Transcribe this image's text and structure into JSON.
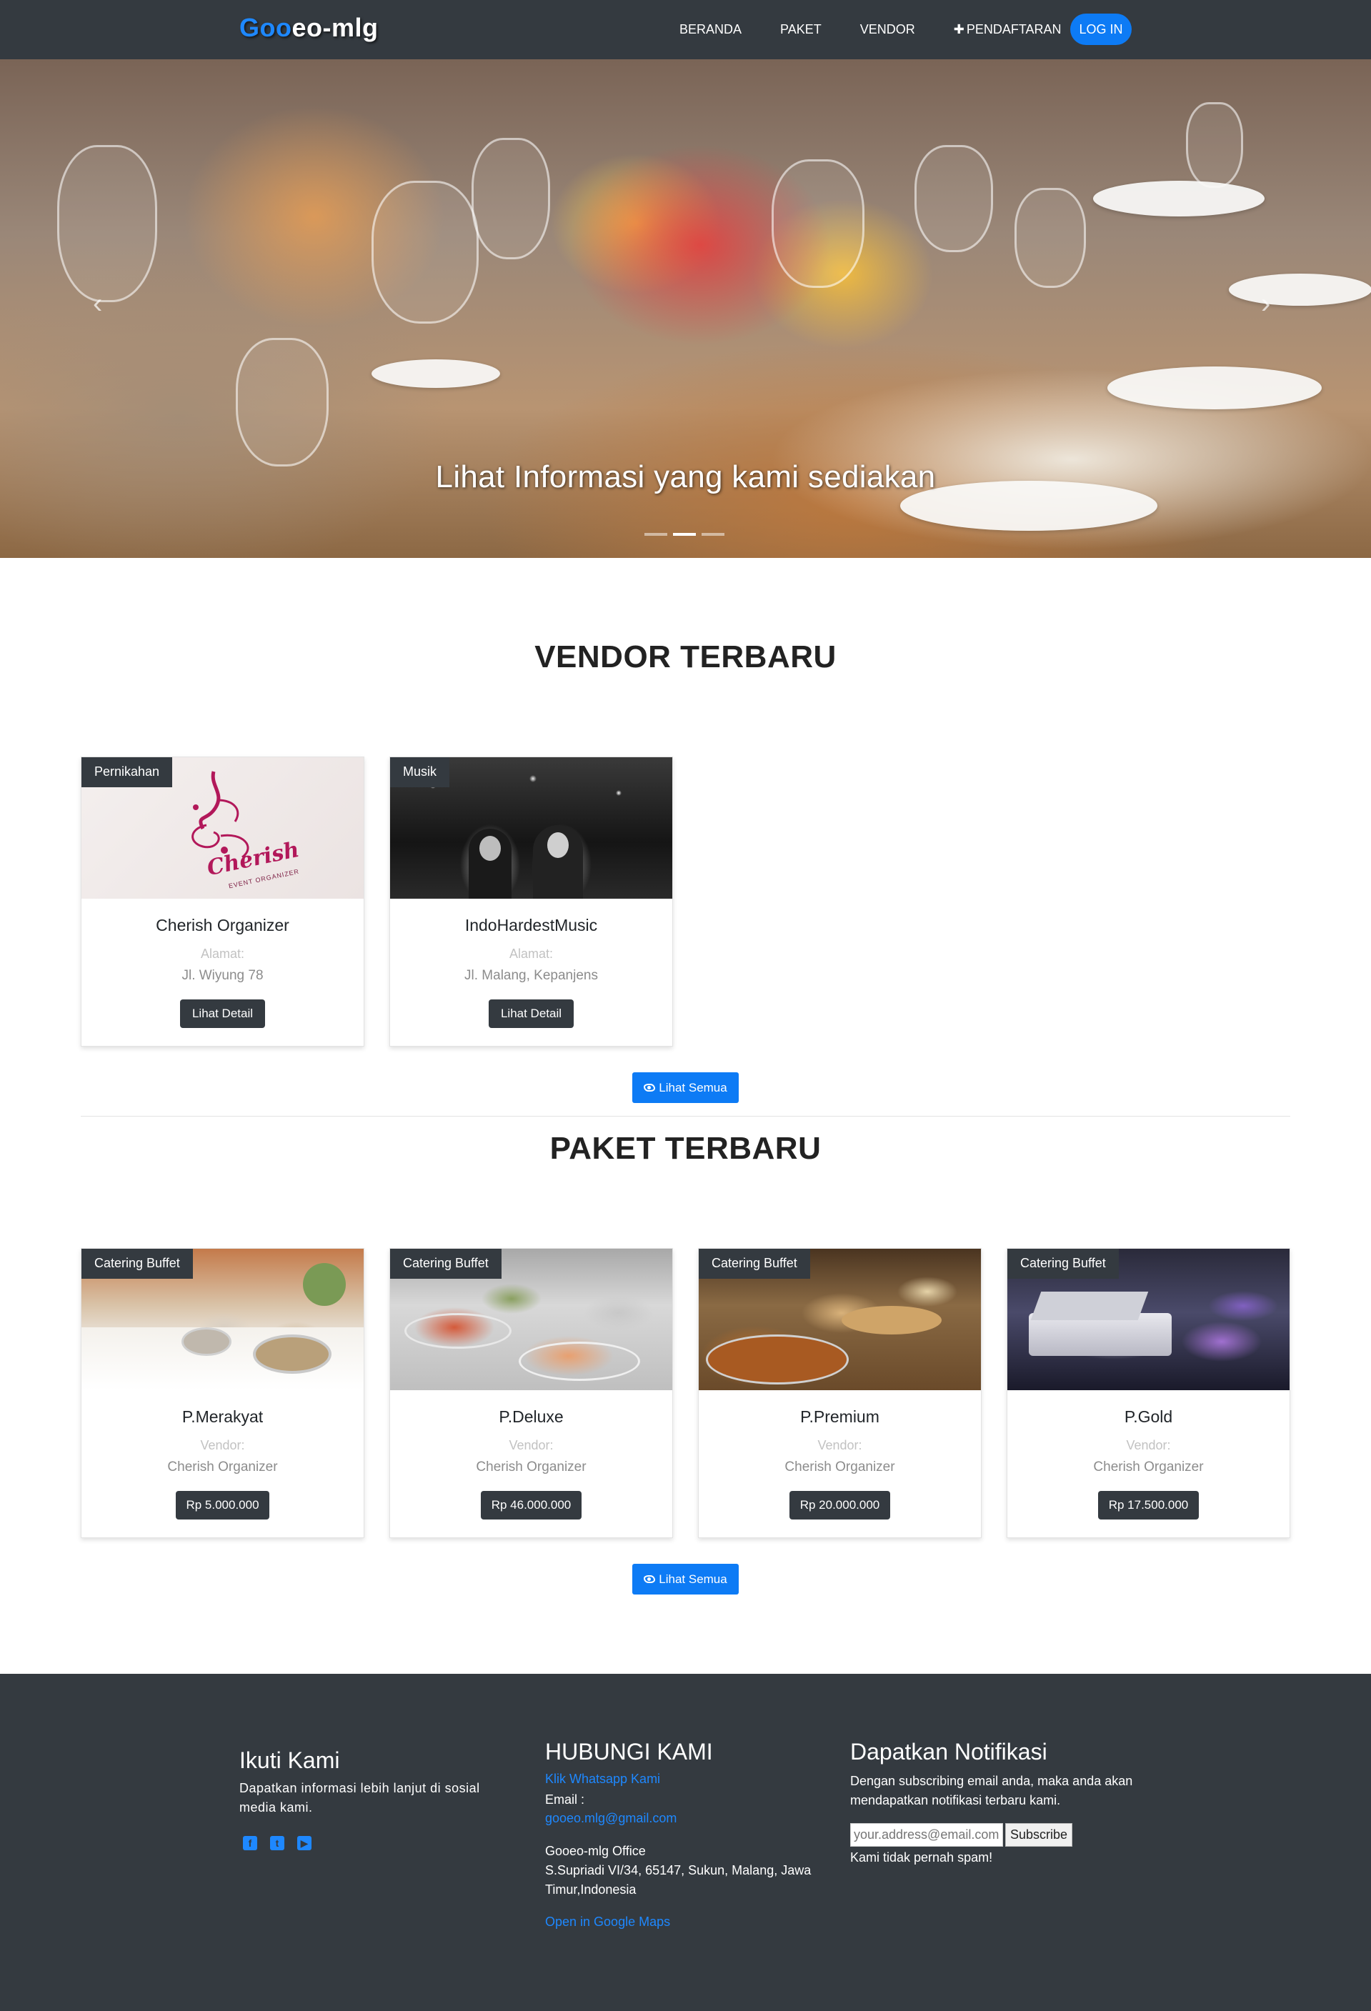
{
  "navbar": {
    "brand_accent": "Goo",
    "brand_rest": "eo-mlg",
    "links": [
      "BERANDA",
      "PAKET",
      "VENDOR",
      "PENDAFTARAN"
    ],
    "login_label": "LOG IN"
  },
  "hero": {
    "caption": "Lihat Informasi yang kami sediakan",
    "slide_count": 3,
    "active_slide": 2
  },
  "vendor_section": {
    "title": "VENDOR TERBARU",
    "address_label": "Alamat:",
    "button_label": "Lihat Detail",
    "see_all": "Lihat Semua",
    "cards": [
      {
        "category": "Pernikahan",
        "name": "Cherish Organizer",
        "address": "Jl. Wiyung 78",
        "logo_text": "Cherish",
        "logo_sub": "EVENT ORGANIZER"
      },
      {
        "category": "Musik",
        "name": "IndoHardestMusic",
        "address": "Jl. Malang, Kepanjens"
      }
    ]
  },
  "package_section": {
    "title": "PAKET TERBARU",
    "vendor_label": "Vendor:",
    "see_all": "Lihat Semua",
    "cards": [
      {
        "category": "Catering Buffet",
        "name": "P.Merakyat",
        "vendor": "Cherish Organizer",
        "price": "Rp 5.000.000"
      },
      {
        "category": "Catering Buffet",
        "name": "P.Deluxe",
        "vendor": "Cherish Organizer",
        "price": "Rp 46.000.000"
      },
      {
        "category": "Catering Buffet",
        "name": "P.Premium",
        "vendor": "Cherish Organizer",
        "price": "Rp 20.000.000"
      },
      {
        "category": "Catering Buffet",
        "name": "P.Gold",
        "vendor": "Cherish Organizer",
        "price": "Rp 17.500.000"
      }
    ]
  },
  "footer": {
    "follow": {
      "title": "Ikuti Kami",
      "text_line1": "Dapatkan informasi lebih lanjut di sosial",
      "text_line2": "media kami.",
      "icons": [
        "facebook-icon",
        "twitter-icon",
        "youtube-icon"
      ]
    },
    "contact": {
      "title": "HUBUNGI KAMI",
      "whatsapp": "Klik Whatsapp Kami",
      "email_label": "Email :",
      "email": "gooeo.mlg@gmail.com",
      "office": "Gooeo-mlg Office",
      "address_line1": "S.Supriadi VI/34, 65147, Sukun, Malang, Jawa",
      "address_line2": "Timur,Indonesia",
      "maps": "Open in Google Maps"
    },
    "notify": {
      "title": "Dapatkan Notifikasi",
      "text_line1": "Dengan subscribing email anda, maka anda akan",
      "text_line2": "mendapatkan notifikasi terbaru kami.",
      "placeholder": "your.address@email.com",
      "button": "Subscribe",
      "note": "Kami tidak pernah spam!"
    }
  },
  "colors": {
    "navbar_bg": "#343a40",
    "accent": "#0d7bf5",
    "link": "#1e88ff"
  }
}
